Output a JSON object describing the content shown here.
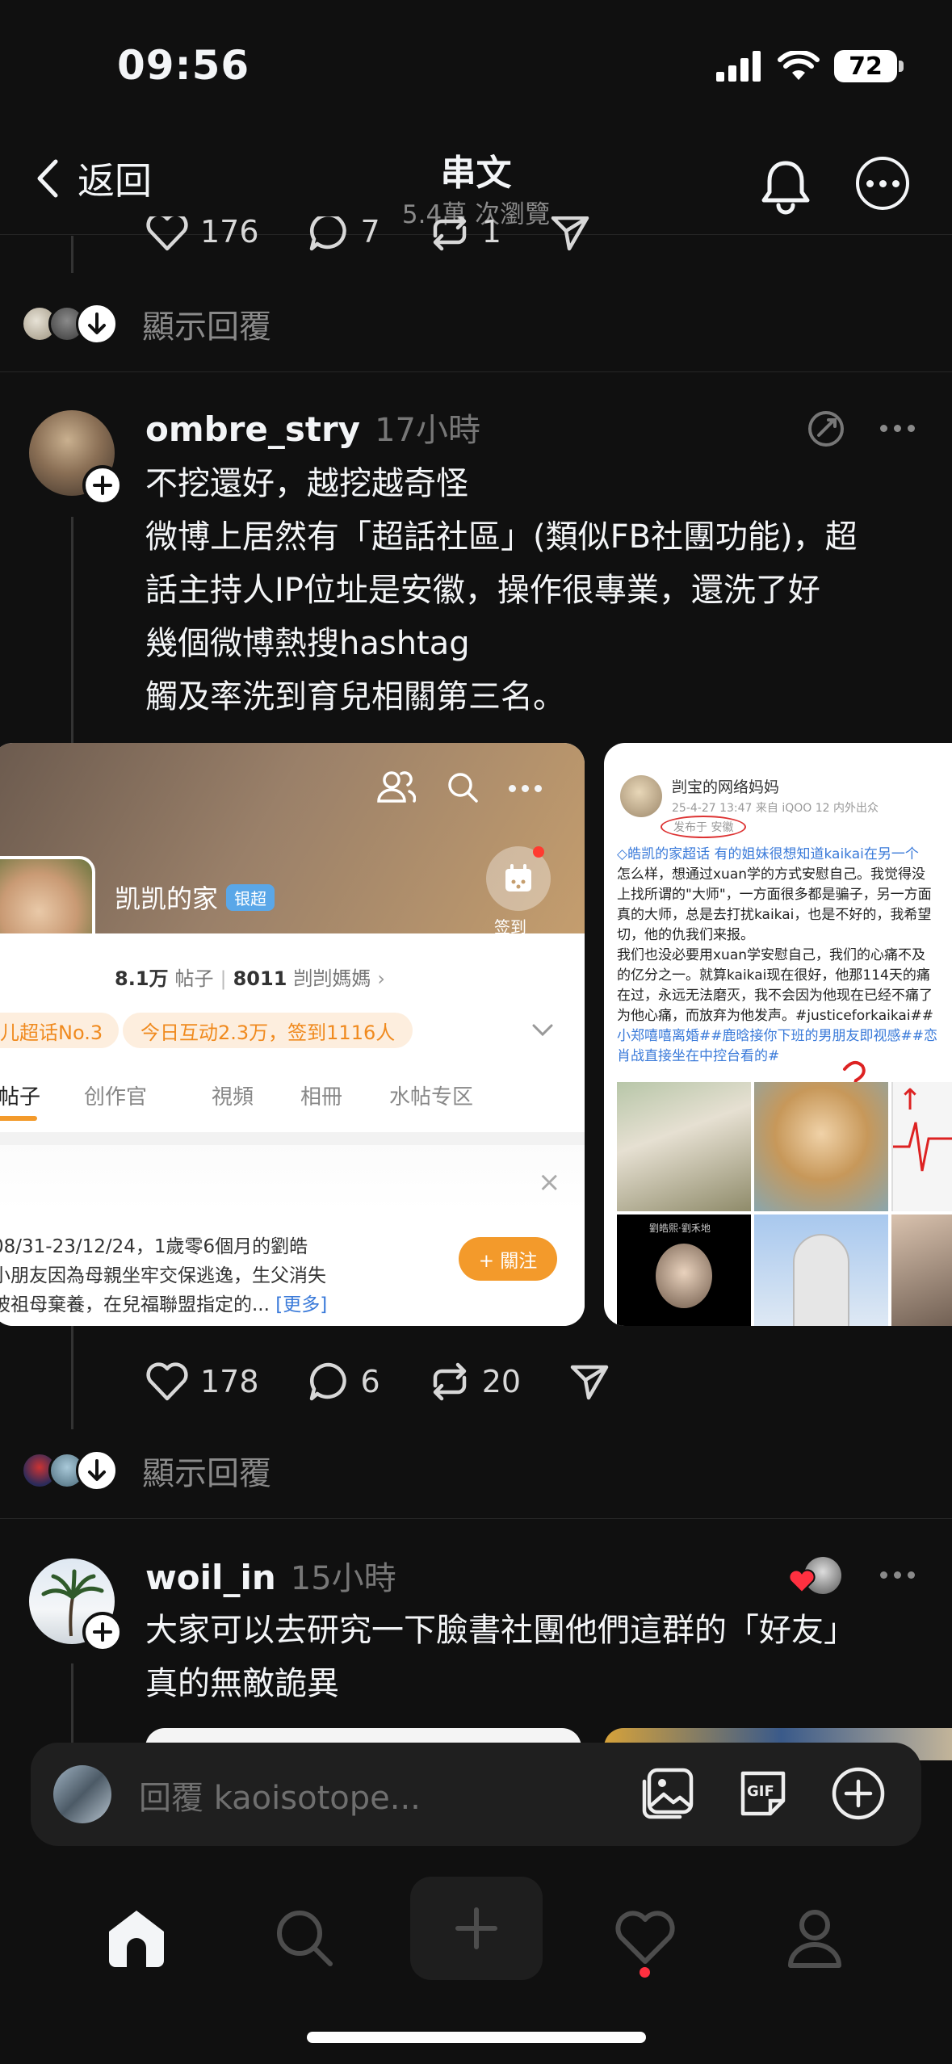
{
  "status_bar": {
    "time": "09:56",
    "battery": "72"
  },
  "header": {
    "back_label": "返回",
    "title": "串文",
    "subtitle": "5.4萬 次瀏覽"
  },
  "prev_post": {
    "likes": "176",
    "comments": "7",
    "reposts": "1"
  },
  "replies_label_1": "顯示回覆",
  "post1": {
    "username": "ombre_stry",
    "time": "17小時",
    "lines": [
      "不挖還好，越挖越奇怪",
      "微博上居然有「超話社區」(類似FB社團功能)，超",
      "話主持人IP位址是安徽，操作很專業，還洗了好",
      "幾個微博熱搜hashtag",
      "觸及率洗到育兒相關第三名。"
    ],
    "likes": "178",
    "comments": "6",
    "reposts": "20"
  },
  "image_left": {
    "group_name": "凯凯的家",
    "badge": "银超",
    "checkin": "签到",
    "posts_count": "8.1万",
    "posts_label": "帖子",
    "members_count": "8011",
    "members_label": "剀剀媽媽",
    "rank_pill": "儿超话No.3",
    "interact_pill": "今日互动2.3万，签到1116人",
    "tabs": [
      "帖子",
      "创作官",
      "視頻",
      "相冊",
      "水帖专区"
    ],
    "desc_1": "08/31-23/12/24，1歲零6個月的劉皓",
    "desc_2": "小朋友因為母親坐牢交保逃逸，生父消失",
    "desc_3": "被祖母棄養，在兒福聯盟指定的...",
    "more": "[更多]",
    "follow": "+ 關注"
  },
  "image_right": {
    "author": "剀宝的网络妈妈",
    "meta": "25-4-27 13:47  来自 iQOO 12 内外出众",
    "published_from": "发布于 安徽",
    "body_lines": [
      "◇皓凯的家超话 有的姐妹很想知道kaikai在另一个",
      "怎么样，想通过xuan学的方式安慰自己。我觉得没",
      "上找所谓的\"大师\"，一方面很多都是骗子，另一方面",
      "真的大师，总是去打扰kaikai，也是不好的，我希望",
      "切，他的仇我们来报。",
      "我们也没必要用xuan学安慰自己，我们的心痛不及",
      "的亿分之一。就算kaikai现在很好，他那114天的痛",
      "在过，永远无法磨灭，我不会因为他现在已经不痛了",
      "为他心痛，而放弃为他发声。#justiceforkaikai##",
      "小郑嘻嘻离婚##鹿晗接你下班的男朋友即视感##恋",
      "肖战直接坐在中控台看的#"
    ],
    "photo_caption": "劉皓熙·劉禾地"
  },
  "replies_label_2": "顯示回覆",
  "post2": {
    "username": "woil_in",
    "time": "15小時",
    "lines": [
      "大家可以去研究一下臉書社團他們這群的「好友」",
      "真的無敵詭異"
    ]
  },
  "composer": {
    "placeholder": "回覆 kaoisotope..."
  },
  "colors": {
    "background": "#101010",
    "accent_orange": "#f39a2b",
    "notification_red": "#ff3040"
  }
}
